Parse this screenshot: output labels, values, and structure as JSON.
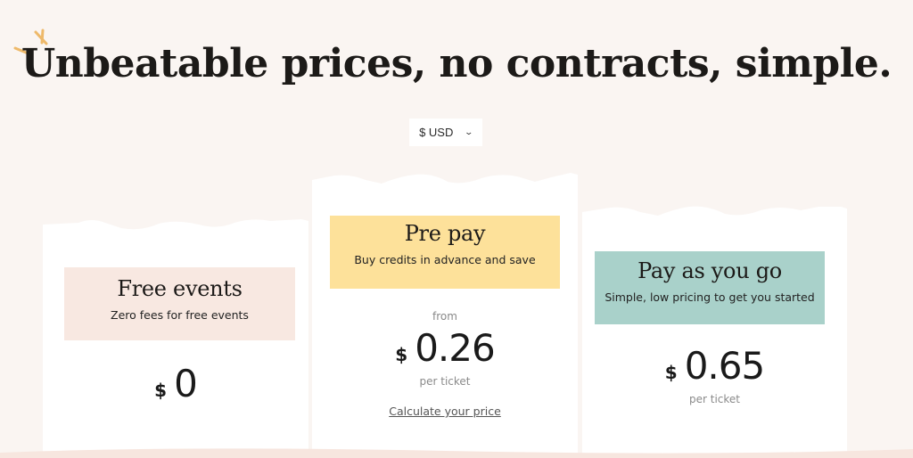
{
  "headline": "Unbeatable prices, no contracts, simple.",
  "currency_selector": {
    "value": "$ USD",
    "icon": "chevron-down-icon"
  },
  "colors": {
    "background": "#faf5f2",
    "sparkle": "#eeb96a",
    "free_label_bg": "#f8e8e1",
    "prepay_label_bg": "#fde19a",
    "payg_label_bg": "#a9d1ca"
  },
  "plans": {
    "free": {
      "title": "Free events",
      "subtitle": "Zero fees for free events",
      "currency_symbol": "$",
      "price": "0"
    },
    "prepay": {
      "title": "Pre pay",
      "subtitle": "Buy credits in advance and save",
      "from_label": "from",
      "currency_symbol": "$",
      "price": "0.26",
      "unit": "per ticket",
      "link": "Calculate your price"
    },
    "payg": {
      "title": "Pay as you go",
      "subtitle": "Simple, low pricing to get you started",
      "currency_symbol": "$",
      "price": "0.65",
      "unit": "per ticket"
    }
  }
}
